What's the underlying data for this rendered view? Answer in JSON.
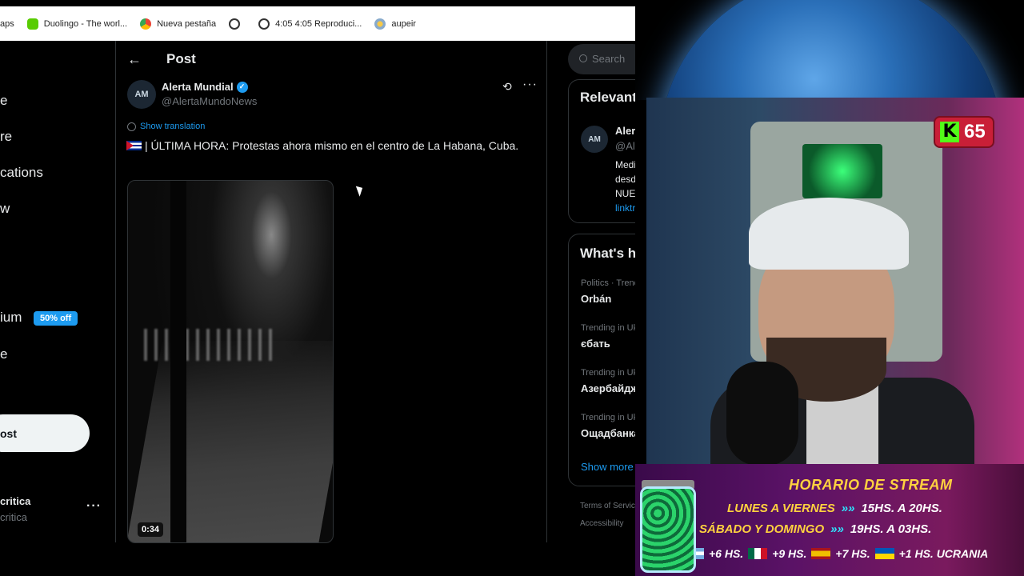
{
  "bookmarks": [
    {
      "label": "aps",
      "icon": "none"
    },
    {
      "label": "Duolingo - The worl...",
      "icon": "duolingo-icon"
    },
    {
      "label": "Nueva pestaña",
      "icon": "chrome-icon"
    },
    {
      "label": "",
      "icon": "globe-icon"
    },
    {
      "label": "4:05 4:05 Reproduci...",
      "icon": "globe-icon"
    },
    {
      "label": "aupeir",
      "icon": "aupeir-icon"
    }
  ],
  "leftnav": {
    "items": [
      "e",
      "re",
      "cations",
      "w",
      "ium",
      "e"
    ],
    "premium_badge": "50% off",
    "post_button": "ost",
    "account_name": "critica",
    "account_handle": "critica",
    "more": "···"
  },
  "main": {
    "back": "←",
    "title": "Post",
    "author": {
      "avatar_text": "AM",
      "name": "Alerta Mundial",
      "handle": "@AlertaMundoNews",
      "verified": "✓"
    },
    "show_translation": "Show translation",
    "tweet_text": "| ÚLTIMA HORA: Protestas ahora mismo en el centro de La Habana, Cuba.",
    "video_duration": "0:34",
    "more": "···",
    "grok": "⟲"
  },
  "right": {
    "search_placeholder": "Search",
    "relevant_title": "Relevant",
    "relevant": {
      "avatar_text": "AM",
      "name": "Alerta",
      "handle": "@Alert",
      "bio": [
        "Medio",
        "desde",
        "NUEST"
      ],
      "link": "linktr.e"
    },
    "whats_title": "What's ha",
    "trends": [
      {
        "category": "Politics · Trendi",
        "name": "Orbán"
      },
      {
        "category": "Trending in Ukra",
        "name": "єбать"
      },
      {
        "category": "Trending in Ukra",
        "name": "Азербайджа"
      },
      {
        "category": "Trending in Ukra",
        "name": "Ощадбанка"
      }
    ],
    "show_more": "Show more",
    "footer": [
      "Terms of Servic",
      "Accessibility"
    ]
  },
  "stream": {
    "kick_count": "65",
    "kick_letter": "K",
    "schedule_title": "HORARIO DE STREAM",
    "rows": [
      {
        "days": "LUNES A VIERNES",
        "time": "15HS. A 20HS."
      },
      {
        "days": "SÁBADO Y DOMINGO",
        "time": "19HS. A 03HS."
      }
    ],
    "timezones": [
      "+6 HS.",
      "+9 HS.",
      "+7 HS.",
      "+1 HS. UCRANIA"
    ],
    "colors": {
      "kick_green": "#53fc18",
      "kick_red": "#c91f37",
      "schedule_yellow": "#ffd23f"
    }
  }
}
